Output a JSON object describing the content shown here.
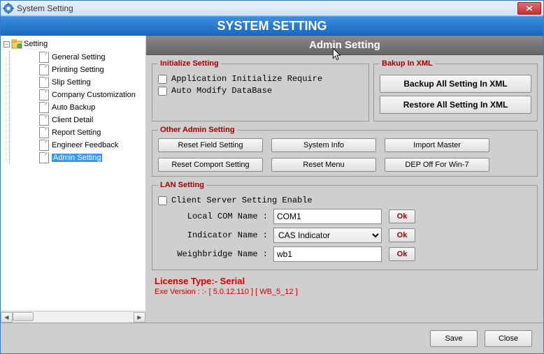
{
  "window": {
    "title": "System Setting"
  },
  "banner": "SYSTEM SETTING",
  "tree": {
    "root": "Setting",
    "items": [
      "General Setting",
      "Printing Setting",
      "Slip Setting",
      "Company Customization",
      "Auto Backup",
      "Client Detail",
      "Report Setting",
      "Engineer Feedback",
      "Admin Setting"
    ],
    "selected": "Admin Setting"
  },
  "content": {
    "header": "Admin Setting",
    "init": {
      "legend": "Initialize Setting",
      "chk1": "Application Initialize Require",
      "chk2": "Auto Modify DataBase"
    },
    "backup": {
      "legend": "Bakup In XML",
      "btn1": "Backup All Setting In XML",
      "btn2": "Restore All Setting In XML"
    },
    "other": {
      "legend": "Other Admin Setting",
      "b1": "Reset Field Setting",
      "b2": "System Info",
      "b3": "Import Master",
      "b4": "Reset Comport Setting",
      "b5": "Reset Menu",
      "b6": "DEP Off For Win-7"
    },
    "lan": {
      "legend": "LAN Setting",
      "chk": "Client Server Setting Enable",
      "l1": "Local COM Name :",
      "v1": "COM1",
      "l2": "Indicator Name :",
      "v2": "CAS Indicator",
      "l3": "Weighbridge Name :",
      "v3": "wb1",
      "ok": "Ok"
    },
    "license": "License Type:- Serial",
    "exe": "Exe Version : :-  [ 5.0.12.110 ] [ WB_5_12 ]"
  },
  "footer": {
    "save": "Save",
    "close": "Close"
  }
}
